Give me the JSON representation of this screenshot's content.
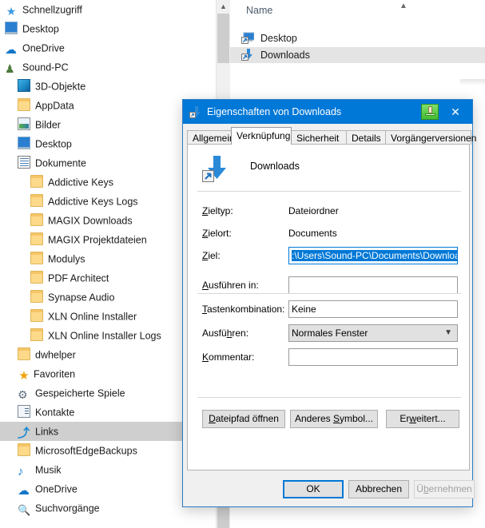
{
  "explorer": {
    "nav_tree": {
      "items": [
        {
          "label": "Schnellzugriff",
          "icon": "quick-access-icon",
          "indent": 0,
          "selected": false
        },
        {
          "label": "Desktop",
          "icon": "desktop-icon",
          "indent": 0,
          "selected": false
        },
        {
          "label": "OneDrive",
          "icon": "onedrive-cloud-icon",
          "indent": 0,
          "selected": false
        },
        {
          "label": "Sound-PC",
          "icon": "user-icon",
          "indent": 0,
          "selected": false
        },
        {
          "label": "3D-Objekte",
          "icon": "3d-objects-icon",
          "indent": 1,
          "selected": false
        },
        {
          "label": "AppData",
          "icon": "folder-icon",
          "indent": 1,
          "selected": false
        },
        {
          "label": "Bilder",
          "icon": "pictures-icon",
          "indent": 1,
          "selected": false
        },
        {
          "label": "Desktop",
          "icon": "desktop-icon",
          "indent": 1,
          "selected": false
        },
        {
          "label": "Dokumente",
          "icon": "documents-icon",
          "indent": 1,
          "selected": false
        },
        {
          "label": "Addictive Keys",
          "icon": "folder-icon",
          "indent": 2,
          "selected": false
        },
        {
          "label": "Addictive Keys Logs",
          "icon": "folder-icon",
          "indent": 2,
          "selected": false
        },
        {
          "label": "MAGIX Downloads",
          "icon": "folder-icon",
          "indent": 2,
          "selected": false
        },
        {
          "label": "MAGIX Projektdateien",
          "icon": "folder-icon",
          "indent": 2,
          "selected": false
        },
        {
          "label": "Modulys",
          "icon": "folder-icon",
          "indent": 2,
          "selected": false
        },
        {
          "label": "PDF Architect",
          "icon": "folder-icon",
          "indent": 2,
          "selected": false
        },
        {
          "label": "Synapse Audio",
          "icon": "folder-icon",
          "indent": 2,
          "selected": false
        },
        {
          "label": "XLN Online Installer",
          "icon": "folder-icon",
          "indent": 2,
          "selected": false
        },
        {
          "label": "XLN Online Installer Logs",
          "icon": "folder-icon",
          "indent": 2,
          "selected": false
        },
        {
          "label": "dwhelper",
          "icon": "folder-icon",
          "indent": 1,
          "selected": false
        },
        {
          "label": "Favoriten",
          "icon": "star-icon",
          "indent": 1,
          "selected": false
        },
        {
          "label": "Gespeicherte Spiele",
          "icon": "saved-games-icon",
          "indent": 1,
          "selected": false
        },
        {
          "label": "Kontakte",
          "icon": "contacts-icon",
          "indent": 1,
          "selected": false
        },
        {
          "label": "Links",
          "icon": "link-icon",
          "indent": 1,
          "selected": true
        },
        {
          "label": "MicrosoftEdgeBackups",
          "icon": "folder-icon",
          "indent": 1,
          "selected": false
        },
        {
          "label": "Musik",
          "icon": "music-icon",
          "indent": 1,
          "selected": false
        },
        {
          "label": "OneDrive",
          "icon": "onedrive-cloud-icon",
          "indent": 1,
          "selected": false
        },
        {
          "label": "Suchvorgänge",
          "icon": "search-icon",
          "indent": 1,
          "selected": false
        }
      ]
    },
    "file_list": {
      "column_header": "Name",
      "sort_indicator": "▲",
      "rows": [
        {
          "name": "Desktop",
          "icon": "desktop-shortcut-icon",
          "selected": false
        },
        {
          "name": "Downloads",
          "icon": "downloads-shortcut-icon",
          "selected": true
        }
      ]
    }
  },
  "dialog": {
    "title": "Eigenschaften von Downloads",
    "title_icon": "shortcut-downloads-icon",
    "toolbar_icon": "green-stamp-icon",
    "close_label": "✕",
    "tabs": [
      {
        "label": "Allgemein",
        "active": false
      },
      {
        "label": "Verknüpfung",
        "active": true
      },
      {
        "label": "Sicherheit",
        "active": false
      },
      {
        "label": "Details",
        "active": false
      },
      {
        "label": "Vorgängerversionen",
        "active": false
      }
    ],
    "panel": {
      "header_title": "Downloads",
      "header_icon": "downloads-shortcut-icon",
      "fields": [
        {
          "label": "Zieltyp:",
          "value": "Dateiordner",
          "type": "static"
        },
        {
          "label": "Zielort:",
          "value": "Documents",
          "type": "static"
        },
        {
          "label": "Ziel:",
          "value": ":\\Users\\Sound-PC\\Documents\\Downloads",
          "type": "text",
          "focused": true,
          "selected": true
        },
        {
          "label": "Ausführen in:",
          "value": "",
          "type": "text",
          "focused": false,
          "selected": false
        },
        {
          "label": "Tastenkombination:",
          "value": "Keine",
          "type": "text",
          "focused": false,
          "selected": false
        },
        {
          "label": "Ausführen:",
          "value": "Normales Fenster",
          "type": "combo",
          "focused": false,
          "selected": false
        },
        {
          "label": "Kommentar:",
          "value": "",
          "type": "text",
          "focused": false,
          "selected": false
        }
      ],
      "action_buttons": [
        {
          "label": "Dateipfad öffnen",
          "accel": "D"
        },
        {
          "label": "Anderes Symbol...",
          "accel": "S"
        },
        {
          "label": "Erweitert...",
          "accel": "w"
        }
      ]
    },
    "footer_buttons": [
      {
        "label": "OK",
        "state": "default"
      },
      {
        "label": "Abbrechen",
        "state": "normal"
      },
      {
        "label": "Übernehmen",
        "state": "disabled"
      }
    ]
  },
  "colors": {
    "accent": "#0078d7",
    "titlebar": "#0078d7",
    "selection": "#0078d7",
    "dialog_bg": "#f0f0f0",
    "nav_selected": "#cfcfcf",
    "list_selected": "#e4e4e4",
    "folder_yellow": "#fdd98a",
    "green_icon": "#46bb31",
    "caret": "#e08020"
  }
}
